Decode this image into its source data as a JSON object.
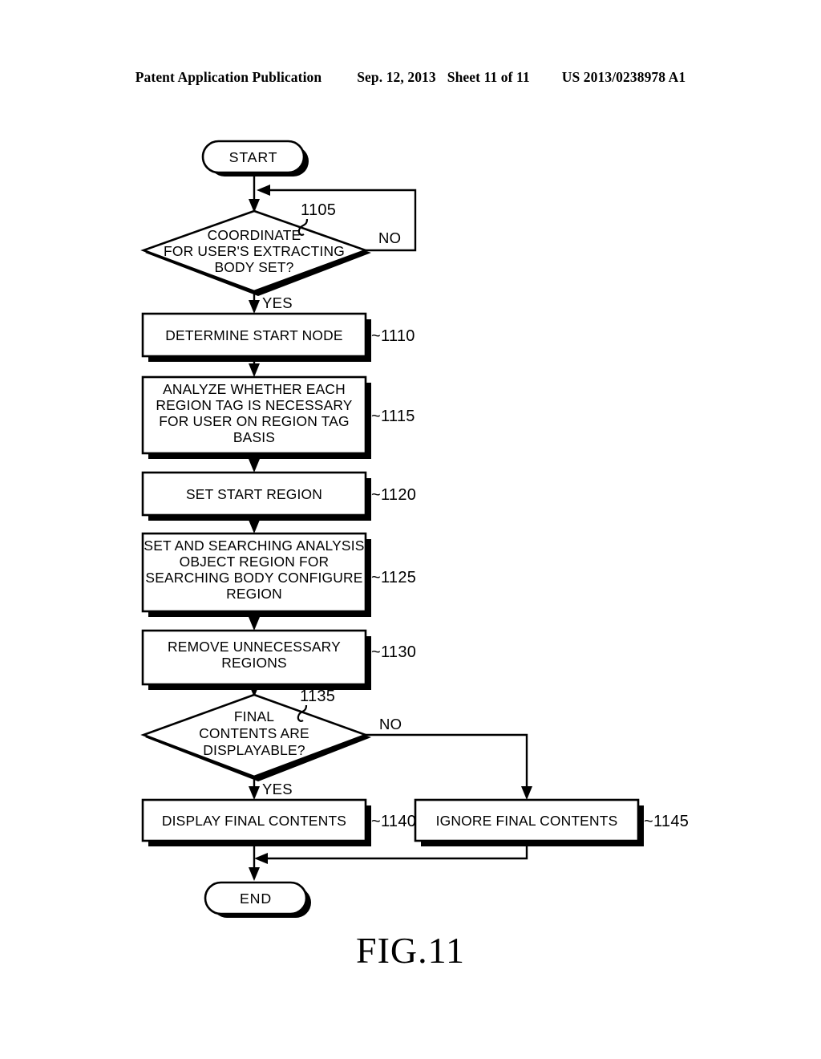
{
  "header": {
    "publication": "Patent Application Publication",
    "date": "Sep. 12, 2013",
    "sheet": "Sheet 11 of 11",
    "number": "US 2013/0238978 A1"
  },
  "figure": {
    "caption": "FIG.11",
    "type": "flowchart"
  },
  "flowchart": {
    "nodes": [
      {
        "id": "start",
        "kind": "terminator",
        "label": "START"
      },
      {
        "id": "d1105",
        "kind": "decision",
        "ref": "1105",
        "lines": [
          "COORDINATE",
          "FOR USER'S EXTRACTING",
          "BODY SET?"
        ]
      },
      {
        "id": "p1110",
        "kind": "process",
        "ref": "1110",
        "lines": [
          "DETERMINE START NODE"
        ]
      },
      {
        "id": "p1115",
        "kind": "process",
        "ref": "1115",
        "lines": [
          "ANALYZE WHETHER EACH",
          "REGION TAG IS NECESSARY",
          "FOR USER ON REGION TAG",
          "BASIS"
        ]
      },
      {
        "id": "p1120",
        "kind": "process",
        "ref": "1120",
        "lines": [
          "SET START REGION"
        ]
      },
      {
        "id": "p1125",
        "kind": "process",
        "ref": "1125",
        "lines": [
          "SET AND SEARCHING ANALYSIS",
          "OBJECT REGION FOR",
          "SEARCHING BODY CONFIGURE",
          "REGION"
        ]
      },
      {
        "id": "p1130",
        "kind": "process",
        "ref": "1130",
        "lines": [
          "REMOVE UNNECESSARY",
          "REGIONS"
        ]
      },
      {
        "id": "d1135",
        "kind": "decision",
        "ref": "1135",
        "lines": [
          "FINAL",
          "CONTENTS ARE",
          "DISPLAYABLE?"
        ]
      },
      {
        "id": "p1140",
        "kind": "process",
        "ref": "1140",
        "lines": [
          "DISPLAY FINAL CONTENTS"
        ]
      },
      {
        "id": "p1145",
        "kind": "process",
        "ref": "1145",
        "lines": [
          "IGNORE FINAL CONTENTS"
        ]
      },
      {
        "id": "end",
        "kind": "terminator",
        "label": "END"
      }
    ],
    "branch_labels": {
      "d1105_no": "NO",
      "d1105_yes": "YES",
      "d1135_no": "NO",
      "d1135_yes": "YES"
    },
    "ref_prefix": "~",
    "refs": {
      "r1105": "1105",
      "r1110": "1110",
      "r1115": "1115",
      "r1120": "1120",
      "r1125": "1125",
      "r1130": "1130",
      "r1135": "1135",
      "r1140": "1140",
      "r1145": "1145"
    },
    "ref_labels": {
      "l1110": "~1110",
      "l1115": "~1115",
      "l1120": "~1120",
      "l1125": "~1125",
      "l1130": "~1130",
      "l1140": "~1140",
      "l1145": "~1145"
    },
    "colors": {
      "line": "#000000",
      "fill": "#ffffff",
      "shadow": "#000000"
    }
  }
}
